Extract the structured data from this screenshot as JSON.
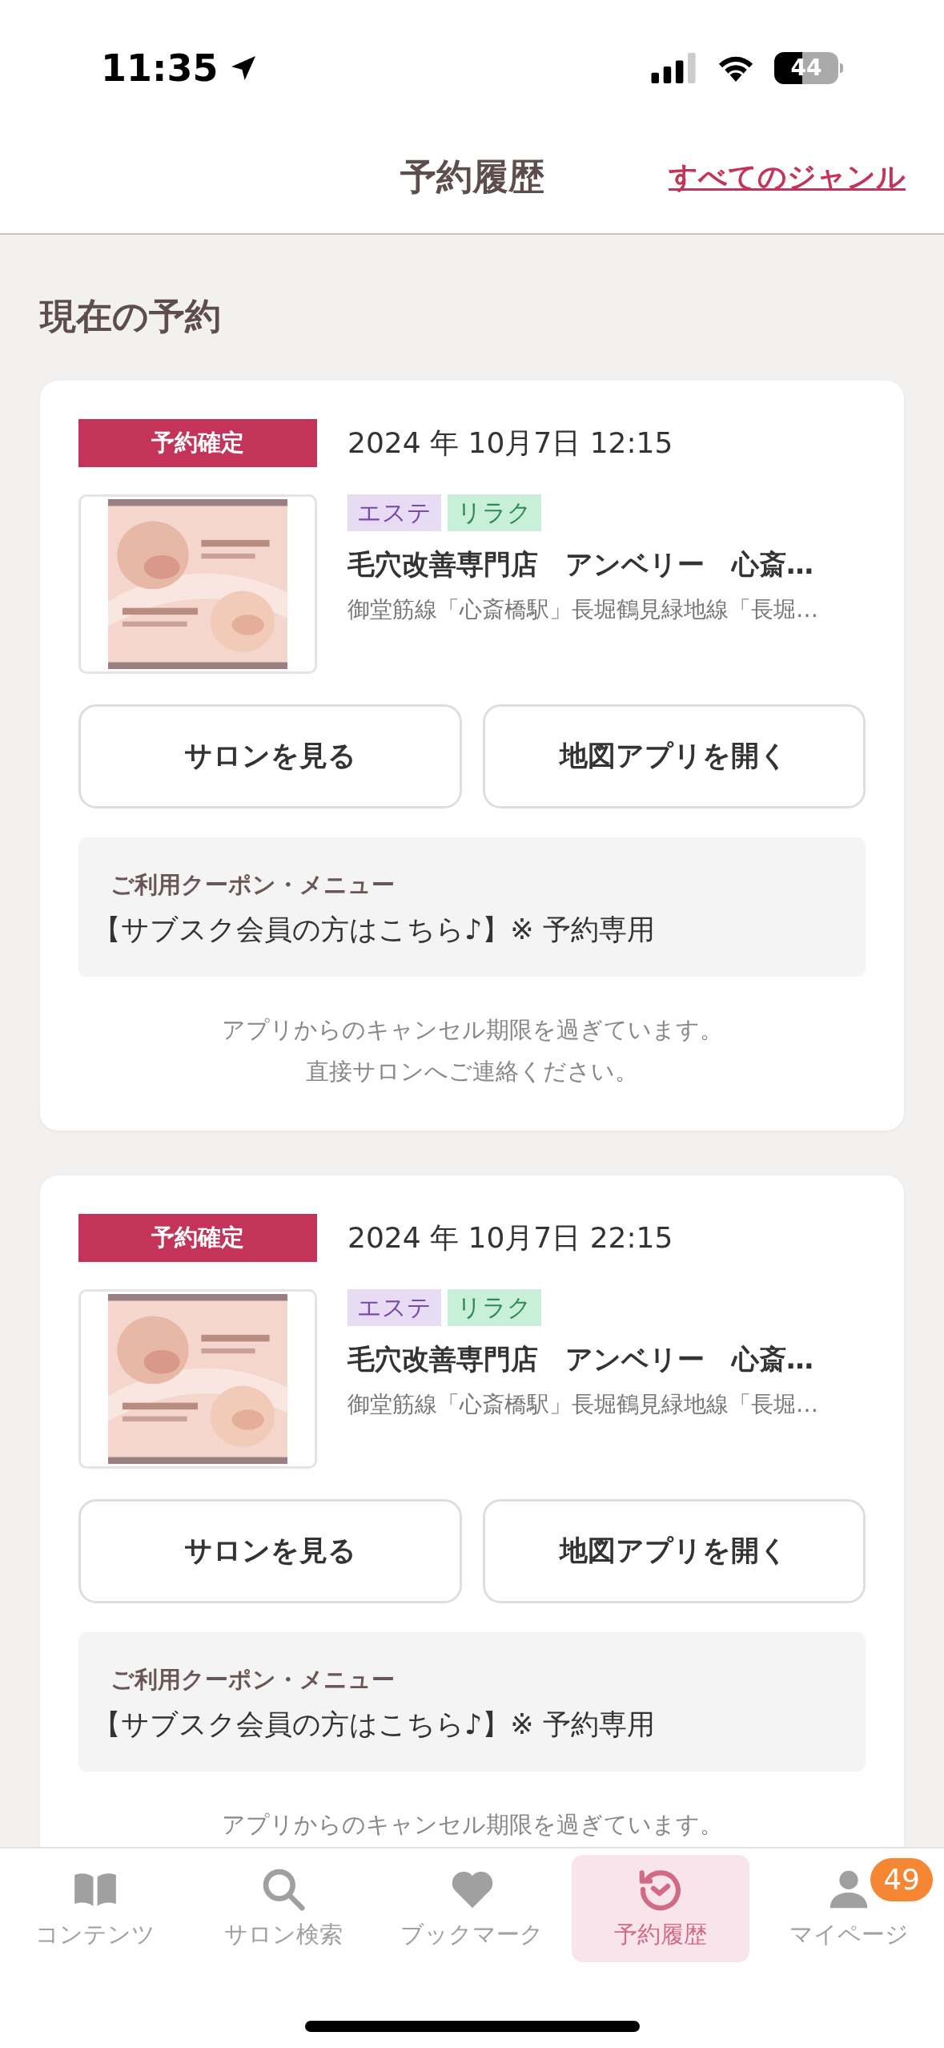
{
  "status_bar": {
    "time": "11:35",
    "battery": "44"
  },
  "header": {
    "title": "予約履歴",
    "link": "すべてのジャンル"
  },
  "section_title": "現在の予約",
  "reservations": [
    {
      "status": "予約確定",
      "datetime": "2024 年 10月7日 12:15",
      "thumbnail": {
        "kind": "picture"
      },
      "tags": [
        {
          "label": "エステ",
          "color": "#e8dcf5"
        },
        {
          "label": "リラク",
          "color": "#c8f0d8"
        }
      ],
      "salon_name": "毛穴改善専門店　アンベリー　心斎…",
      "access": "御堂筋線「心斎橋駅」長堀鶴見緑地線「長堀…",
      "buttons": [
        "サロンを見る",
        "地図アプリを開く"
      ],
      "coupon_label": "ご利用クーポン・メニュー",
      "coupon": "【サブスク会員の方はこちら♪】※ 予約専用",
      "note": [
        "アプリからのキャンセル期限を過ぎています。",
        "直接サロンへご連絡ください。"
      ]
    },
    {
      "status": "予約確定",
      "datetime": "2024 年 10月7日 22:15",
      "thumbnail": {
        "kind": "picture"
      },
      "tags": [
        {
          "label": "エステ",
          "color": "#e8dcf5"
        },
        {
          "label": "リラク",
          "color": "#c8f0d8"
        }
      ],
      "salon_name": "毛穴改善専門店　アンベリー　心斎…",
      "access": "御堂筋線「心斎橋駅」長堀鶴見緑地線「長堀…",
      "buttons": [
        "サロンを見る",
        "地図アプリを開く"
      ],
      "coupon_label": "ご利用クーポン・メニュー",
      "coupon": "【サブスク会員の方はこちら♪】※ 予約専用",
      "note": [
        "アプリからのキャンセル期限を過ぎています。"
      ]
    }
  ],
  "tab_bar": [
    {
      "kind": "book",
      "label": "コンテンツ",
      "selected": false
    },
    {
      "kind": "search",
      "label": "サロン検索",
      "selected": false
    },
    {
      "kind": "heart",
      "label": "ブックマーク",
      "selected": false
    },
    {
      "kind": "history",
      "label": "予約履歴",
      "selected": true
    },
    {
      "kind": "person",
      "label": "マイページ",
      "selected": false,
      "badge": "49"
    }
  ]
}
